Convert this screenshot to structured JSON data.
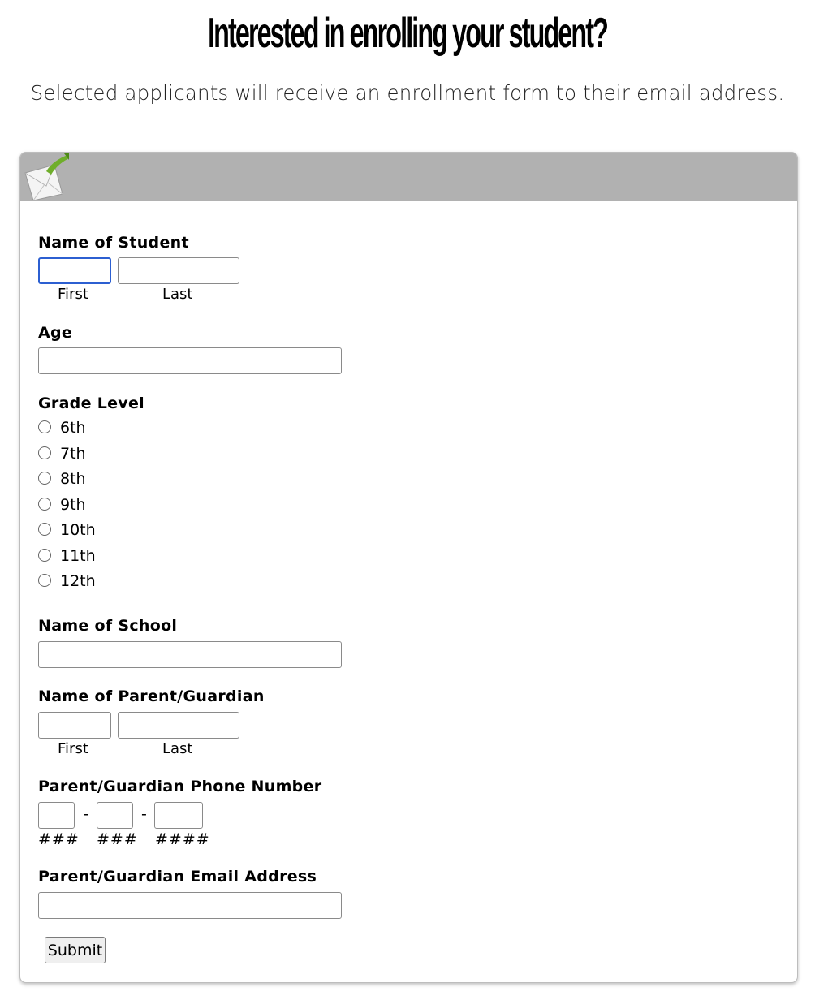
{
  "page": {
    "heading": "Interested in enrolling your student?",
    "subheading": "Selected applicants will receive an enrollment form to their email address."
  },
  "form": {
    "student_name": {
      "label": "Name of Student",
      "first_caption": "First",
      "last_caption": "Last",
      "first_value": "",
      "last_value": ""
    },
    "age": {
      "label": "Age",
      "value": ""
    },
    "grade_level": {
      "label": "Grade Level",
      "options": [
        "6th",
        "7th",
        "8th",
        "9th",
        "10th",
        "11th",
        "12th"
      ],
      "selected": null
    },
    "school_name": {
      "label": "Name of School",
      "value": ""
    },
    "parent_name": {
      "label": "Name of Parent/Guardian",
      "first_caption": "First",
      "last_caption": "Last",
      "first_value": "",
      "last_value": ""
    },
    "phone": {
      "label": "Parent/Guardian Phone Number",
      "separator": "-",
      "hints": [
        "###",
        "###",
        "####"
      ]
    },
    "email": {
      "label": "Parent/Guardian Email Address",
      "value": ""
    },
    "submit_label": "Submit"
  },
  "colors": {
    "header_bar": "#b1b1b1",
    "focus_ring": "#2c5fd1",
    "envelope_arrow": "#6fae2a"
  },
  "icons": {
    "header": "mail-envelope-icon"
  }
}
